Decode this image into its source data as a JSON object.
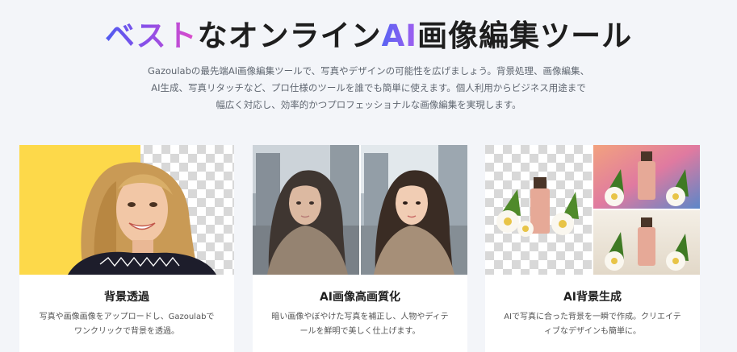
{
  "hero": {
    "title_part1": "ベスト",
    "title_part2": "なオンライン",
    "title_part3": "AI",
    "title_part4": "画像編集ツール",
    "description_lines": [
      "Gazoulabの最先端AI画像編集ツールで、写真やデザインの可能性を広げましょう。背景処理、画像編集、",
      "AI生成、写真リタッチなど、プロ仕様のツールを誰でも簡単に使えます。個人利用からビジネス用途まで",
      "幅広く対応し、効率的かつプロフェッショナルな画像編集を実現します。"
    ]
  },
  "cards": [
    {
      "title": "背景透過",
      "text_lines": [
        "写真や画像画像をアップロードし、Gazoulabで",
        "ワンクリックで背景を透過。"
      ]
    },
    {
      "title": "AI画像高画質化",
      "text_lines": [
        "暗い画像やぼやけた写真を補正し、人物やディテ",
        "ールを鮮明で美しく仕上げます。"
      ]
    },
    {
      "title": "AI背景生成",
      "text_lines": [
        "AIで写真に合った背景を一瞬で作成。クリエイテ",
        "ィブなデザインも簡単に。"
      ]
    }
  ],
  "colors": {
    "accent_blue": "#5060f0",
    "accent_pink": "#e24bc9",
    "page_bg": "#f3f5f9",
    "yellow_bg": "#fdd94a"
  },
  "icons": {
    "card1_image": "portrait-transparent-background-image",
    "card2_image": "portrait-enhance-before-after-image",
    "card3_image": "cosmetic-bottle-ai-background-image"
  }
}
